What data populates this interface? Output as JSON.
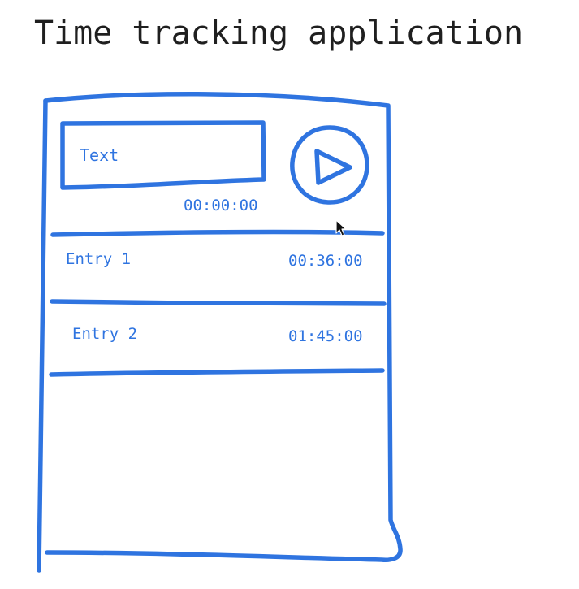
{
  "title": "Time tracking application",
  "accent_color": "#2f74e0",
  "tracker": {
    "text_placeholder": "Text",
    "timer": "00:00:00",
    "play_icon": "play-icon"
  },
  "entries": [
    {
      "name": "Entry 1",
      "duration": "00:36:00"
    },
    {
      "name": "Entry 2",
      "duration": "01:45:00"
    }
  ]
}
